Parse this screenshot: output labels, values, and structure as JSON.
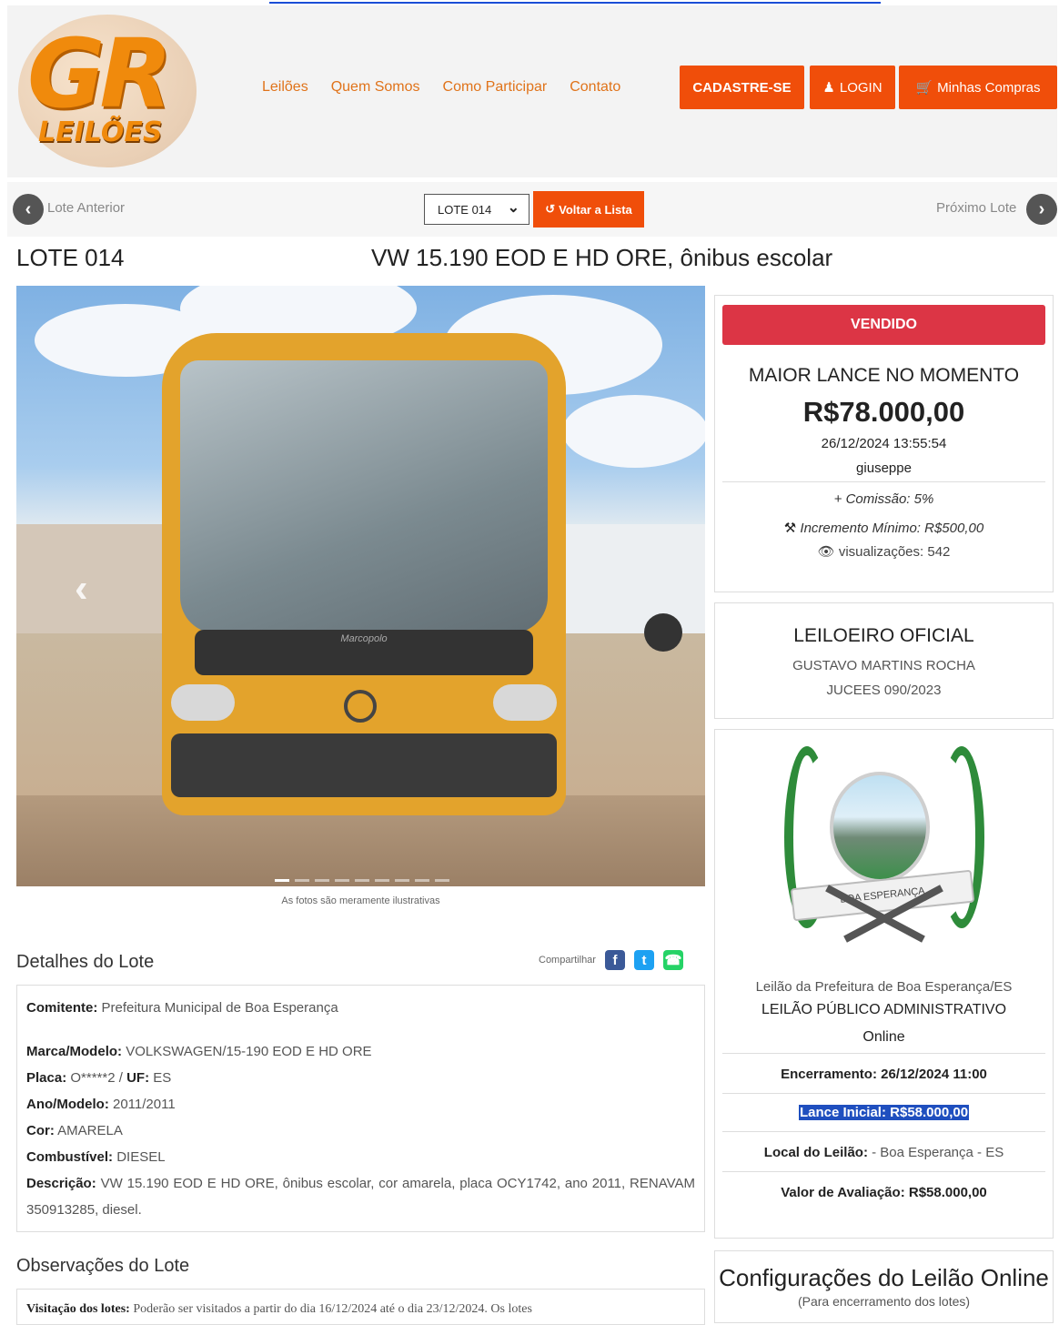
{
  "header": {
    "logo_text": "GR",
    "logo_sub": "LEILÕES",
    "nav": [
      "Leilões",
      "Quem Somos",
      "Como Participar",
      "Contato"
    ],
    "register_label": "CADASTRE-SE",
    "login_label": "LOGIN",
    "purchases_label": "Minhas Compras"
  },
  "lot_nav": {
    "prev_label": "Lote Anterior",
    "select_value": "LOTE 014",
    "back_label": "Voltar a Lista",
    "next_label": "Próximo Lote"
  },
  "lot": {
    "code": "LOTE 014",
    "title": "VW 15.190 EOD E HD ORE, ônibus escolar",
    "photo_caption": "As fotos são meramente ilustrativas",
    "photo_label": "Marcopolo",
    "carousel_count": 9,
    "carousel_active": 1
  },
  "details": {
    "heading": "Detalhes do Lote",
    "share_label": "Compartilhar",
    "comitente_label": "Comitente:",
    "comitente": "Prefeitura Municipal de Boa Esperança",
    "marca_label": "Marca/Modelo:",
    "marca": "VOLKSWAGEN/15-190 EOD E HD ORE",
    "placa_label": "Placa:",
    "placa": "O*****2 /",
    "uf_label": "UF:",
    "uf": "ES",
    "ano_label": "Ano/Modelo:",
    "ano": "2011/2011",
    "cor_label": "Cor:",
    "cor": "AMARELA",
    "comb_label": "Combustível:",
    "comb": "DIESEL",
    "desc_label": "Descrição:",
    "desc": "VW 15.190 EOD E HD ORE, ônibus escolar, cor amarela, placa OCY1742, ano 2011, RENAVAM 350913285, diesel."
  },
  "observations": {
    "heading": "Observações do Lote",
    "visit_label": "Visitação dos lotes:",
    "visit_text": "Poderão ser visitados a partir do dia 16/12/2024 até o dia 23/12/2024. Os lotes"
  },
  "bid": {
    "status": "VENDIDO",
    "heading": "MAIOR LANCE NO MOMENTO",
    "amount": "R$78.000,00",
    "datetime": "26/12/2024 13:55:54",
    "user": "giuseppe",
    "commission": "+ Comissão: 5%",
    "increment": "Incremento Mínimo: R$500,00",
    "views": "visualizações: 542"
  },
  "auctioneer": {
    "heading": "LEILOEIRO OFICIAL",
    "name": "GUSTAVO MARTINS ROCHA",
    "registry": "JUCEES 090/2023"
  },
  "auction": {
    "seal_text": "BOA ESPERANÇA",
    "name": "Leilão da Prefeitura de Boa Esperança/ES",
    "type": "LEILÃO PÚBLICO ADMINISTRATIVO",
    "mode": "Online",
    "end_label": "Encerramento:",
    "end_value": "26/12/2024 11:00",
    "initial_label": "Lance Inicial:",
    "initial_value": "R$58.000,00",
    "place_label": "Local do Leilão:",
    "place_value": "- Boa Esperança - ES",
    "valuation_label": "Valor de Avaliação:",
    "valuation_value": "R$58.000,00"
  },
  "settings": {
    "heading": "Configurações do Leilão Online",
    "sub": "(Para encerramento dos lotes)"
  },
  "colors": {
    "accent": "#f04e0a",
    "sold": "#dc3545",
    "link": "#e0731a"
  }
}
